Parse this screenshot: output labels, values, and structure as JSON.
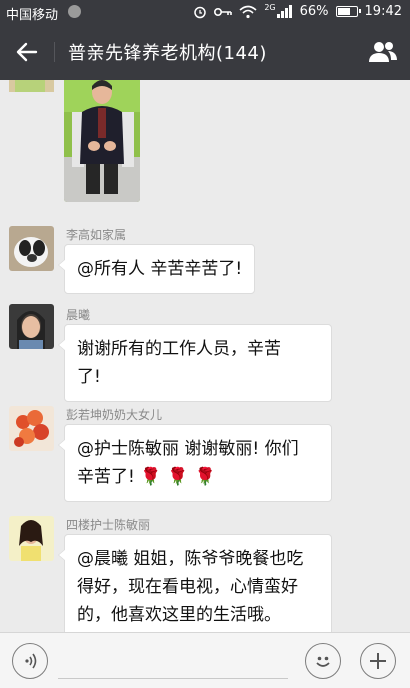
{
  "status_bar": {
    "carrier": "中国移动",
    "network": "2G",
    "battery": "66%",
    "battery_level": 0.66,
    "time": "19:42"
  },
  "header": {
    "title": "普亲先锋养老机构(144)",
    "back_icon": "arrow-left-icon",
    "members_icon": "group-members-icon"
  },
  "messages": [
    {
      "sender": "李高如家属",
      "text": "@所有人 辛苦辛苦了!"
    },
    {
      "sender": "晨曦",
      "text_lines": [
        "谢谢所有的工作人员，辛苦",
        "了!"
      ]
    },
    {
      "sender": "彭若坤奶奶大女儿",
      "text_lines": [
        "@护士陈敏丽 谢谢敏丽! 你们",
        "辛苦了!"
      ],
      "emoji": "🌹🌹🌹"
    },
    {
      "sender": "四楼护士陈敏丽",
      "text_lines": [
        "@晨曦 姐姐，陈爷爷晚餐也吃",
        "得好，现在看电视，心情蛮好",
        "的，他喜欢这里的生活哦。"
      ]
    }
  ],
  "input_bar": {
    "voice_icon": "voice-icon",
    "emoji_icon": "emoji-icon",
    "plus_icon": "plus-icon"
  },
  "colors": {
    "header_bg": "#393a3f",
    "chat_bg": "#ebebeb",
    "bubble_bg": "#ffffff"
  }
}
